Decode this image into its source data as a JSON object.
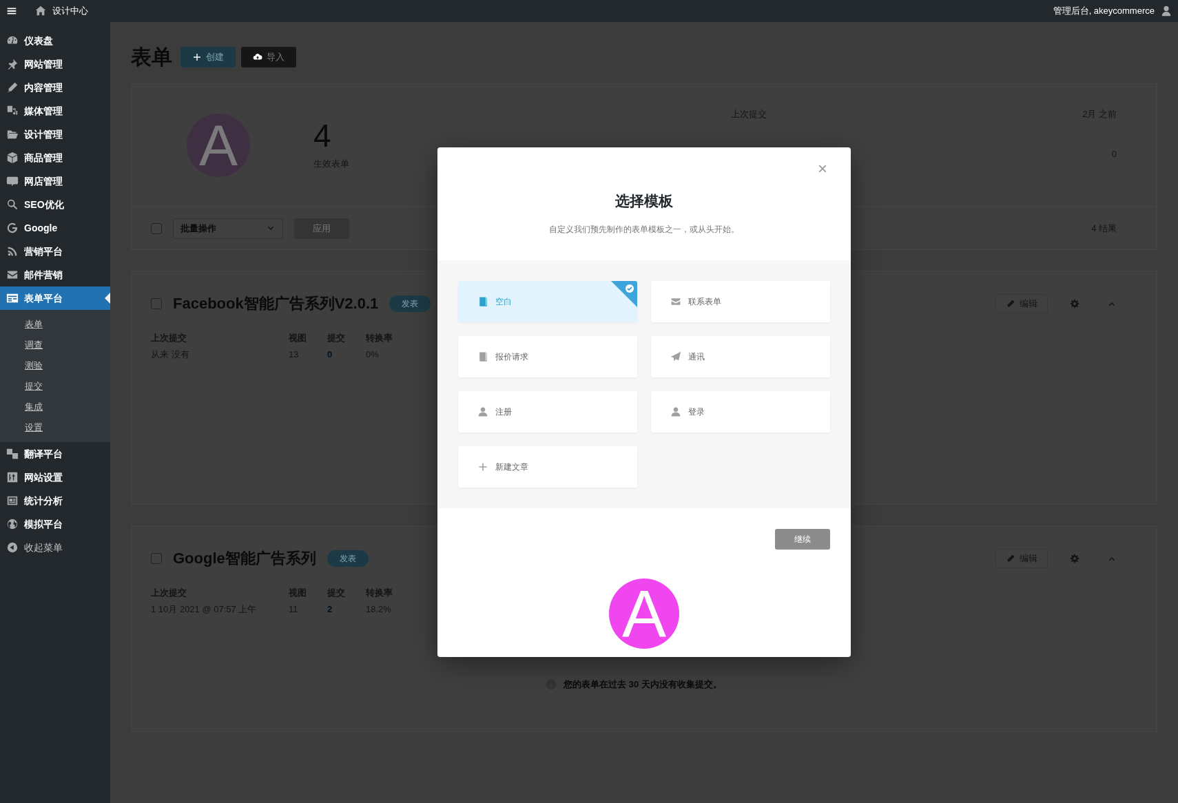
{
  "topbar": {
    "site": "设计中心",
    "user": "管理后台, akeycommerce"
  },
  "sidebar": {
    "items": [
      {
        "label": "仪表盘",
        "selected": false
      },
      {
        "label": "网站管理",
        "selected": false
      },
      {
        "label": "内容管理",
        "selected": false
      },
      {
        "label": "媒体管理",
        "selected": false
      },
      {
        "label": "设计管理",
        "selected": false
      },
      {
        "label": "商品管理",
        "selected": false
      },
      {
        "label": "网店管理",
        "selected": false
      },
      {
        "label": "SEO优化",
        "selected": false
      },
      {
        "label": "Google",
        "selected": false
      },
      {
        "label": "营销平台",
        "selected": false
      },
      {
        "label": "邮件营销",
        "selected": false
      },
      {
        "label": "表单平台",
        "selected": true,
        "children": [
          {
            "label": "表单"
          },
          {
            "label": "调查"
          },
          {
            "label": "测验"
          },
          {
            "label": "提交"
          },
          {
            "label": "集成"
          },
          {
            "label": "设置"
          }
        ]
      },
      {
        "label": "翻译平台",
        "selected": false
      },
      {
        "label": "网站设置",
        "selected": false
      },
      {
        "label": "统计分析",
        "selected": false
      },
      {
        "label": "模拟平台",
        "selected": false
      },
      {
        "label": "收起菜单",
        "selected": false,
        "kind": "collapse"
      }
    ]
  },
  "page": {
    "title": "表单",
    "buttons": [
      {
        "label": "创建",
        "kind": "primary"
      },
      {
        "label": "导入",
        "kind": "secondary"
      }
    ],
    "summary": {
      "logo": "A",
      "count": "4",
      "count_label": "生效表单",
      "stats": [
        {
          "label": "上次提交",
          "value": "2月 之前"
        },
        {
          "value": "0"
        }
      ]
    },
    "bulk": {
      "checked": false,
      "select": "批量操作",
      "apply": "应用",
      "results": "4 结果"
    },
    "forms": [
      {
        "checked": false,
        "title": "Facebook智能广告系列V2.0.1",
        "status": "发表",
        "edit": "编辑",
        "columns": [
          "上次提交",
          "视图",
          "提交",
          "转换率"
        ],
        "values": [
          "从来 没有",
          "13",
          "0",
          "0%"
        ]
      },
      {
        "checked": false,
        "title": "Google智能广告系列",
        "status": "发表",
        "edit": "编辑",
        "columns": [
          "上次提交",
          "视图",
          "提交",
          "转换率"
        ],
        "values": [
          "1 10月 2021 @ 07:57 上午",
          "11",
          "2",
          "18.2%"
        ],
        "notice": "您的表单在过去 30 天内没有收集提交。"
      }
    ]
  },
  "modal": {
    "close": "×",
    "title": "选择模板",
    "subtitle": "自定义我们预先制作的表单模板之一，或从头开始。",
    "templates": [
      {
        "label": "空白",
        "selected": true
      },
      {
        "label": "联系表单",
        "selected": false
      },
      {
        "label": "报价请求",
        "selected": false
      },
      {
        "label": "通讯",
        "selected": false
      },
      {
        "label": "注册",
        "selected": false
      },
      {
        "label": "登录",
        "selected": false
      },
      {
        "label": "新建文章",
        "selected": false
      }
    ],
    "continue": "继续",
    "logo": "A"
  }
}
